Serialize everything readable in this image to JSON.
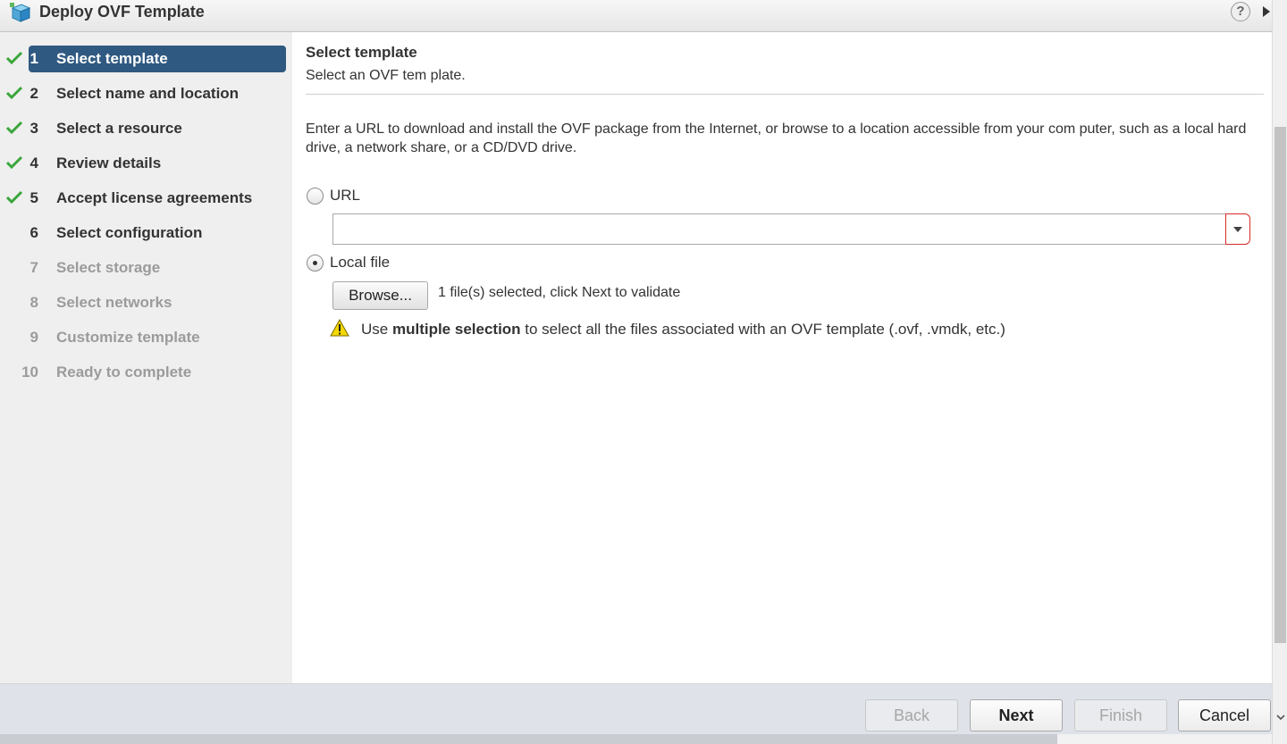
{
  "window": {
    "title": "Deploy OVF Template",
    "help_label": "?"
  },
  "sidebar": {
    "steps": [
      {
        "num": "1",
        "label": "Select template",
        "state": "active",
        "checked": true
      },
      {
        "num": "2",
        "label": "Select name and location",
        "state": "done",
        "checked": true
      },
      {
        "num": "3",
        "label": "Select a resource",
        "state": "done",
        "checked": true
      },
      {
        "num": "4",
        "label": "Review details",
        "state": "done",
        "checked": true
      },
      {
        "num": "5",
        "label": "Accept license agreements",
        "state": "done",
        "checked": true
      },
      {
        "num": "6",
        "label": "Select configuration",
        "state": "done",
        "checked": false
      },
      {
        "num": "7",
        "label": "Select storage",
        "state": "future",
        "checked": false
      },
      {
        "num": "8",
        "label": "Select networks",
        "state": "future",
        "checked": false
      },
      {
        "num": "9",
        "label": "Customize template",
        "state": "future",
        "checked": false
      },
      {
        "num": "10",
        "label": "Ready to complete",
        "state": "future",
        "checked": false
      }
    ]
  },
  "content": {
    "title": "Select template",
    "subtitle": "Select an OVF tem plate.",
    "description": "Enter a URL to download and install the OVF package from the Internet, or browse to a location accessible from your com puter, such as a local hard drive, a network share, or a CD/DVD drive.",
    "url_option": {
      "label": "URL",
      "selected": false,
      "value": ""
    },
    "local_option": {
      "label": "Local file",
      "selected": true
    },
    "browse_label": "Browse...",
    "browse_status": "1 file(s) selected, click Next to validate",
    "warning": {
      "prefix": "Use ",
      "bold": "multiple selection",
      "suffix": " to select all the files associated with an OVF template (.ovf, .vmdk, etc.)"
    }
  },
  "footer": {
    "back": "Back",
    "next": "Next",
    "finish": "Finish",
    "cancel": "Cancel"
  },
  "colors": {
    "active_step": "#2f5981",
    "check": "#3aa63a",
    "footer_bg": "#dfe3e9",
    "url_dropdown_border": "#d42b2b",
    "warning_icon": "#f5d800"
  }
}
